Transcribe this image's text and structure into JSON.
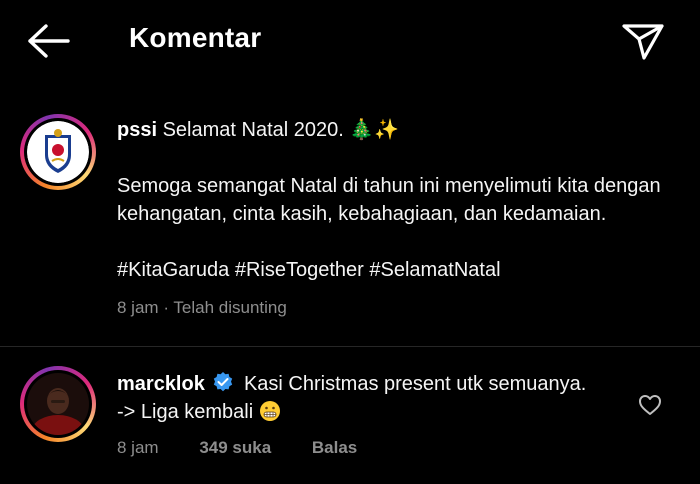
{
  "header": {
    "title": "Komentar",
    "back_icon": "arrow-left-icon",
    "share_icon": "paper-plane-icon"
  },
  "caption": {
    "username": "pssi",
    "first_line": "Selamat Natal 2020. 🎄✨",
    "paragraph": "Semoga semangat Natal di tahun ini menyelimuti kita dengan kehangatan, cinta kasih, kebahagiaan, dan kedamaian.",
    "hashtags": "#KitaGaruda #RiseTogether #SelamatNatal",
    "time": "8 jam",
    "separator": "·",
    "edited": "Telah disunting"
  },
  "comment": {
    "username": "marcklok",
    "text_line1": "Kasi Christmas present utk semuanya.",
    "text_line2": "-> Liga kembali",
    "time": "8 jam",
    "likes": "349 suka",
    "reply": "Balas"
  },
  "colors": {
    "background": "#000000",
    "text": "#f5f5f5",
    "muted": "#8e8e8e",
    "verified": "#3897f0"
  }
}
